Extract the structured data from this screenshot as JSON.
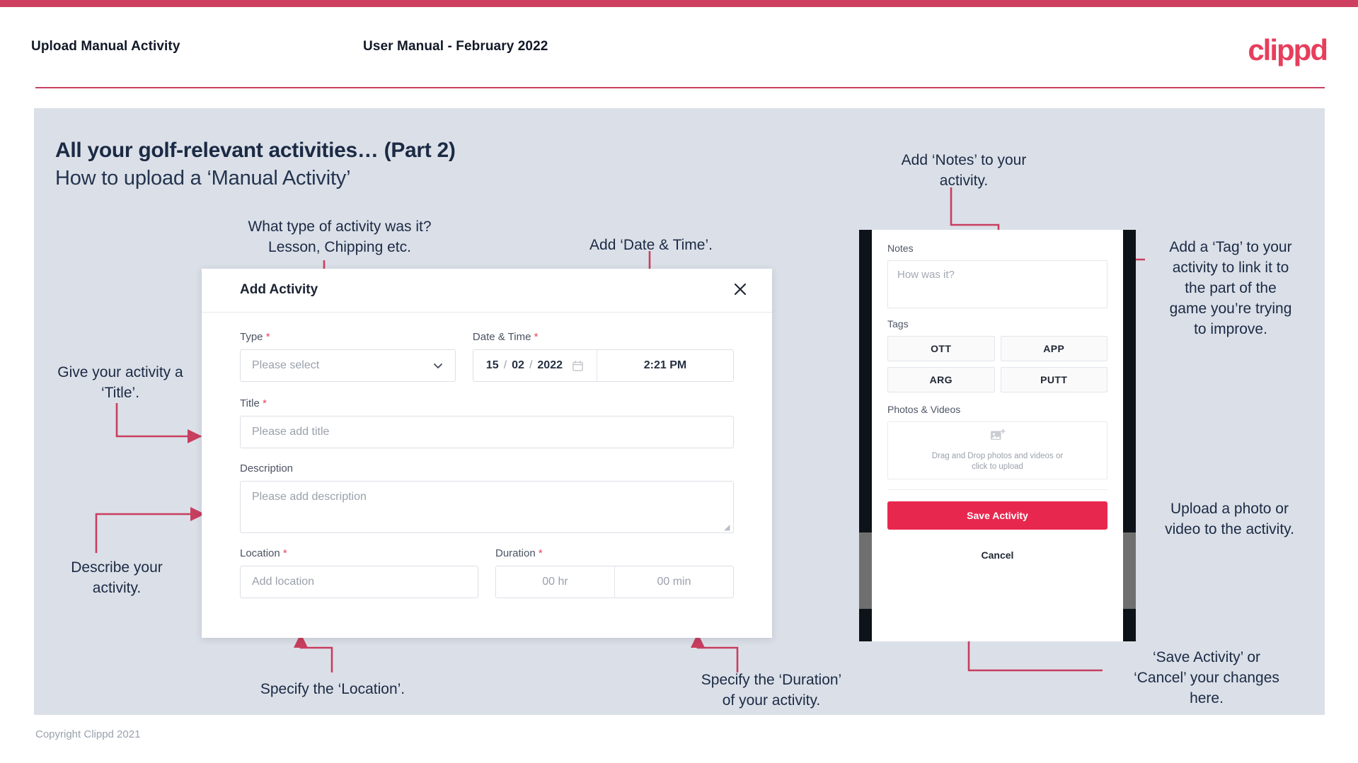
{
  "header": {
    "title": "Upload Manual Activity",
    "subtitle": "User Manual - February 2022",
    "logo": "clippd"
  },
  "slide": {
    "title": "All your golf-relevant activities… (Part 2)",
    "subtitle": "How to upload a ‘Manual Activity’"
  },
  "annotations": {
    "type": "What type of activity was it?\nLesson, Chipping etc.",
    "date_time": "Add ‘Date & Time’.",
    "title_field": "Give your activity a\n‘Title’.",
    "description": "Describe your\nactivity.",
    "location": "Specify the ‘Location’.",
    "duration": "Specify the ‘Duration’\nof your activity.",
    "notes": "Add ‘Notes’ to your\nactivity.",
    "tag": "Add a ‘Tag’ to your\nactivity to link it to\nthe part of the\ngame you’re trying\nto improve.",
    "upload": "Upload a photo or\nvideo to the activity.",
    "save_cancel": "‘Save Activity’ or\n‘Cancel’ your changes\nhere."
  },
  "modal": {
    "title": "Add Activity",
    "close_icon": "close-icon",
    "fields": {
      "type": {
        "label": "Type",
        "required": "*",
        "placeholder": "Please select",
        "chevron_icon": "chevron-down-icon"
      },
      "datetime": {
        "label": "Date & Time",
        "required": "*",
        "day": "15",
        "month": "02",
        "year": "2022",
        "separator": "/",
        "time": "2:21 PM",
        "calendar_icon": "calendar-icon"
      },
      "title": {
        "label": "Title",
        "required": "*",
        "placeholder": "Please add title"
      },
      "description": {
        "label": "Description",
        "required": "",
        "placeholder": "Please add description"
      },
      "location": {
        "label": "Location",
        "required": "*",
        "placeholder": "Add location"
      },
      "duration": {
        "label": "Duration",
        "required": "*",
        "hours_placeholder": "00 hr",
        "minutes_placeholder": "00 min"
      }
    }
  },
  "phone": {
    "notes": {
      "label": "Notes",
      "placeholder": "How was it?"
    },
    "tags": {
      "label": "Tags",
      "items": [
        "OTT",
        "APP",
        "ARG",
        "PUTT"
      ]
    },
    "photos": {
      "label": "Photos & Videos",
      "dropzone_line1": "Drag and Drop photos and videos or",
      "dropzone_line2": "click to upload",
      "icon": "add-image-icon"
    },
    "save_label": "Save Activity",
    "cancel_label": "Cancel"
  },
  "footer": {
    "copyright": "Copyright Clippd 2021"
  },
  "colors": {
    "brand_pink": "#e8274f",
    "top_bar": "#cf4060",
    "slide_bg": "#dbe0e8",
    "connector": "#c83e5e",
    "text_dark": "#1b2a44"
  }
}
